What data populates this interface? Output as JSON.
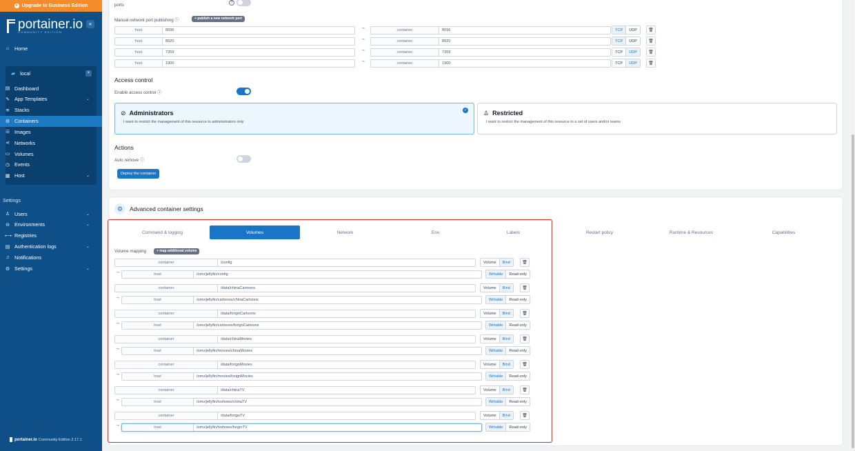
{
  "sidebar": {
    "upgrade_label": "Upgrade to Business Edition",
    "logo_text": "portainer.io",
    "logo_sub": "COMMUNITY EDITION",
    "collapse_icon": "«",
    "home_label": "Home",
    "environment_name": "local",
    "env_items": [
      {
        "label": "Dashboard",
        "icon": "dashboard-icon",
        "glyph": "▤"
      },
      {
        "label": "App Templates",
        "icon": "edit-icon",
        "glyph": "✎",
        "chevron": true
      },
      {
        "label": "Stacks",
        "icon": "stack-icon",
        "glyph": "≋"
      },
      {
        "label": "Containers",
        "icon": "container-icon",
        "glyph": "⚙",
        "active": true
      },
      {
        "label": "Images",
        "icon": "images-icon",
        "glyph": "☰"
      },
      {
        "label": "Networks",
        "icon": "network-icon",
        "glyph": "⋖"
      },
      {
        "label": "Volumes",
        "icon": "volume-icon",
        "glyph": "▭"
      },
      {
        "label": "Events",
        "icon": "clock-icon",
        "glyph": "◷"
      },
      {
        "label": "Host",
        "icon": "host-icon",
        "glyph": "▦",
        "chevron": true
      }
    ],
    "settings_heading": "Settings",
    "settings_items": [
      {
        "label": "Users",
        "icon": "users-icon",
        "glyph": "♙",
        "chevron": true
      },
      {
        "label": "Environments",
        "icon": "environments-icon",
        "glyph": "⊖",
        "chevron": true
      },
      {
        "label": "Registries",
        "icon": "registries-icon",
        "glyph": "⟷"
      },
      {
        "label": "Authentication logs",
        "icon": "logs-icon",
        "glyph": "▤",
        "chevron": true
      },
      {
        "label": "Notifications",
        "icon": "bell-icon",
        "glyph": "♫"
      },
      {
        "label": "Settings",
        "icon": "gear-icon",
        "glyph": "⚙",
        "chevron": true
      }
    ],
    "footer_brand": "portainer.io",
    "footer_version": "Community Edition 2.17.1"
  },
  "ports": {
    "top_text": "ports",
    "label": "Manual network port publishing",
    "add_button": "+ publish a new network port",
    "host_key": "host",
    "container_key": "container",
    "rows": [
      {
        "host": "8096",
        "container": "8096",
        "protocol": "TCP"
      },
      {
        "host": "8920",
        "container": "8920",
        "protocol": "TCP"
      },
      {
        "host": "7359",
        "container": "7359",
        "protocol": "UDP"
      },
      {
        "host": "1900",
        "container": "1900",
        "protocol": "UDP"
      }
    ],
    "tcp": "TCP",
    "udp": "UDP"
  },
  "access": {
    "heading": "Access control",
    "enable_label": "Enable access control",
    "admin_title": "Administrators",
    "admin_desc": "I want to restrict the management of this resource to administrators only",
    "restricted_title": "Restricted",
    "restricted_desc": "I want to restrict the management of this resource to a set of users and/or teams"
  },
  "actions": {
    "heading": "Actions",
    "auto_remove_label": "Auto remove",
    "deploy_button": "Deploy the container"
  },
  "advanced": {
    "title": "Advanced container settings",
    "tabs": [
      "Command & logging",
      "Volumes",
      "Network",
      "Env",
      "Labels",
      "Restart policy",
      "Runtime & Resources",
      "Capabilities"
    ],
    "active_tab": "Volumes"
  },
  "volumes": {
    "label": "Volume mapping",
    "add_button": "+ map additional volume",
    "container_key": "container",
    "host_key": "host",
    "volume_opt": "Volume",
    "bind_opt": "Bind",
    "writable_opt": "Writable",
    "readonly_opt": "Read-only",
    "rows": [
      {
        "container": "/config",
        "host": "/omv/jellyfin/config"
      },
      {
        "container": "/data/chinaCartoons",
        "host": "/omv/jellyfin/cartoons/chinaCartoons"
      },
      {
        "container": "/data/forignCartoons",
        "host": "/omv/jellyfin/cartoons/forignCartoons"
      },
      {
        "container": "/data/chinaMovies",
        "host": "/omv/jellyfin/movies/chinaMovies"
      },
      {
        "container": "/data/forignMovies",
        "host": "/omv/jellyfin/movies/forignMovies"
      },
      {
        "container": "/data/chinaTV",
        "host": "/omv/jellyfin/tvshows/chinaTV"
      },
      {
        "container": "/data/forignTV",
        "host": "/omv/jellyfin/tvshows/forginTV"
      }
    ]
  },
  "colors": {
    "accent": "#1a75c7",
    "sidebar": "#0d4f86",
    "upgrade": "#f48c2b",
    "highlight": "#e32525"
  }
}
